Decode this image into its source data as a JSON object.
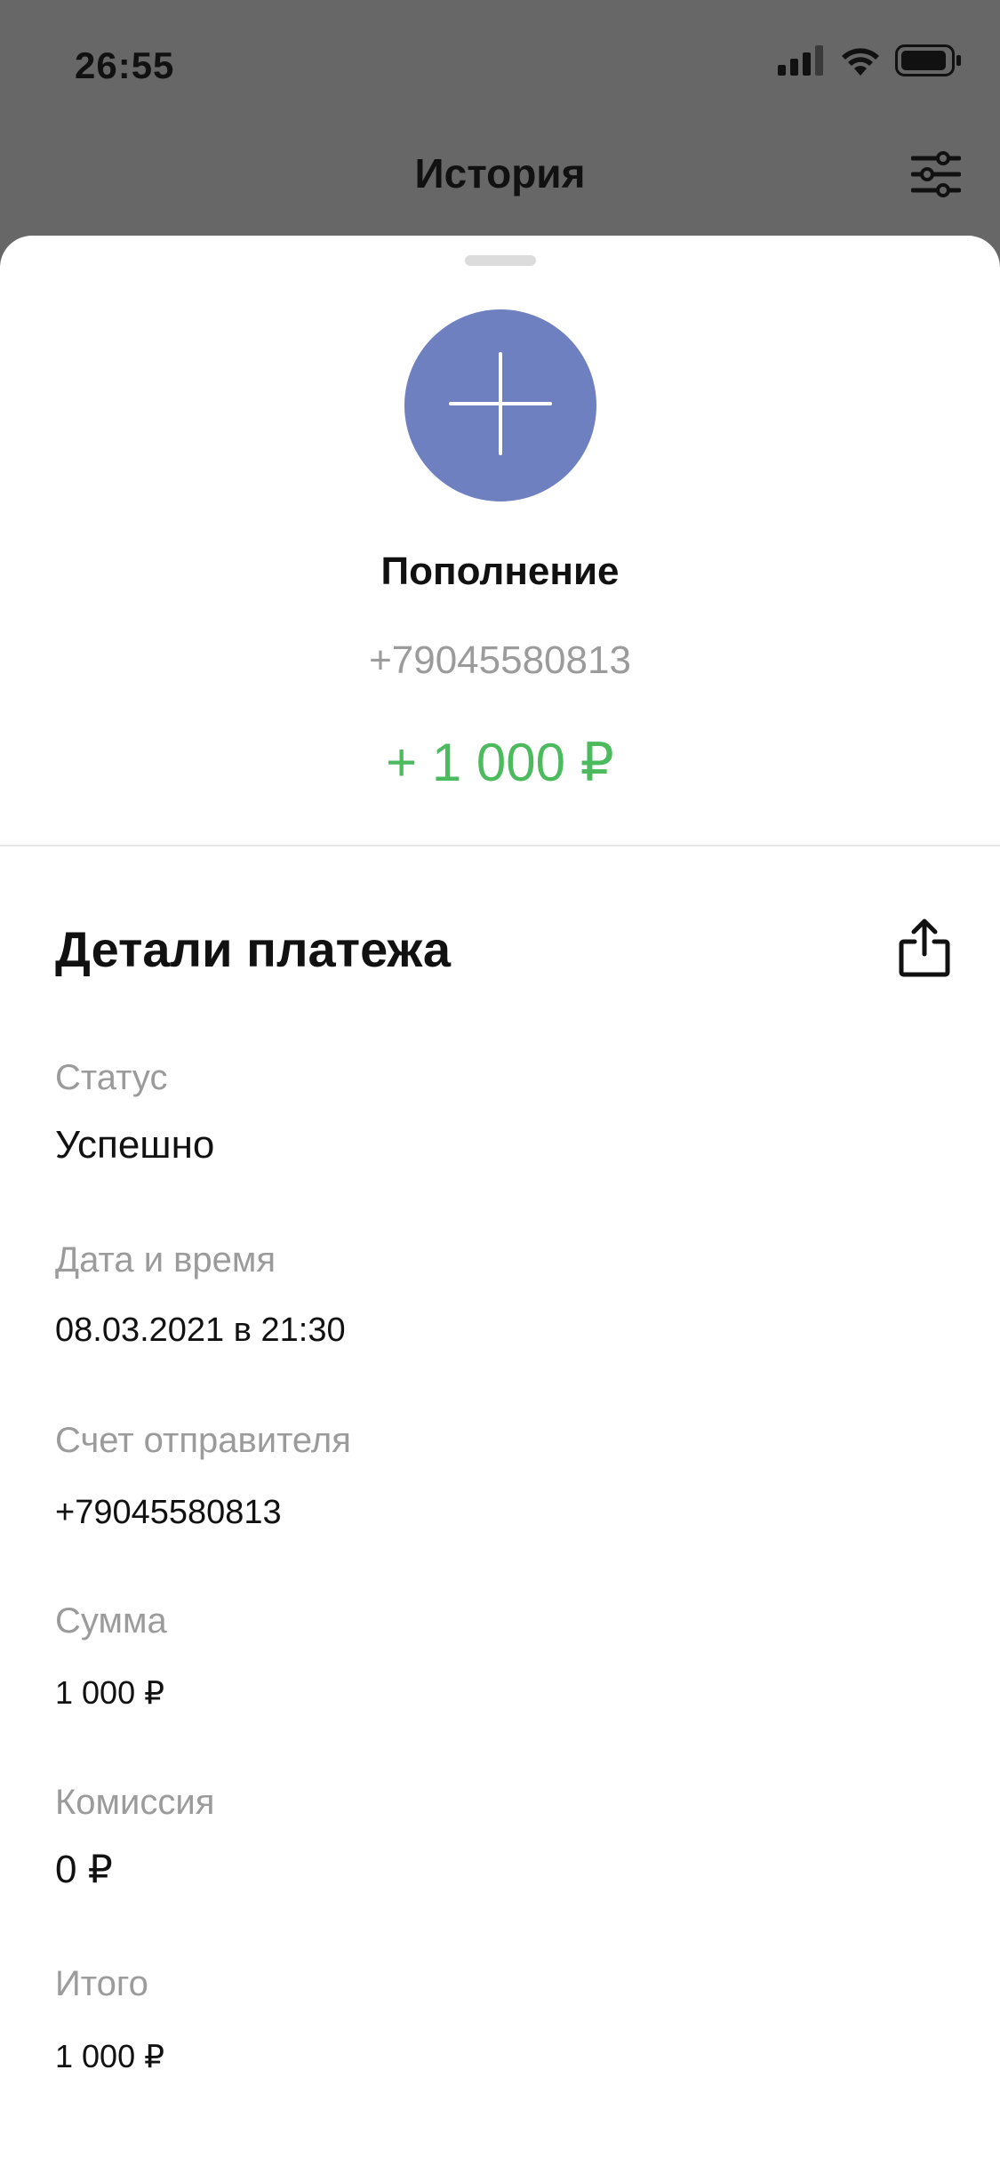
{
  "status_bar": {
    "time": "26:55",
    "icons": [
      "signal-icon",
      "wifi-icon",
      "battery-icon"
    ]
  },
  "header": {
    "title": "История",
    "filter_icon": "filter-sliders-icon"
  },
  "transaction": {
    "icon": "plus-icon",
    "title": "Пополнение",
    "phone": "+79045580813",
    "amount": "+ 1 000 ₽",
    "amount_color": "#4cbb5e",
    "avatar_color": "#6e80c0"
  },
  "details": {
    "title": "Детали платежа",
    "share_icon": "share-icon",
    "fields": [
      {
        "label": "Статус",
        "value": "Успешно"
      },
      {
        "label": "Дата и время",
        "value": "08.03.2021 в 21:30"
      },
      {
        "label": "Счет отправителя",
        "value": "+79045580813"
      },
      {
        "label": "Сумма",
        "value": "1 000 ₽"
      },
      {
        "label": "Комиссия",
        "value": "0 ₽"
      },
      {
        "label": "Итого",
        "value": "1 000 ₽"
      }
    ]
  }
}
